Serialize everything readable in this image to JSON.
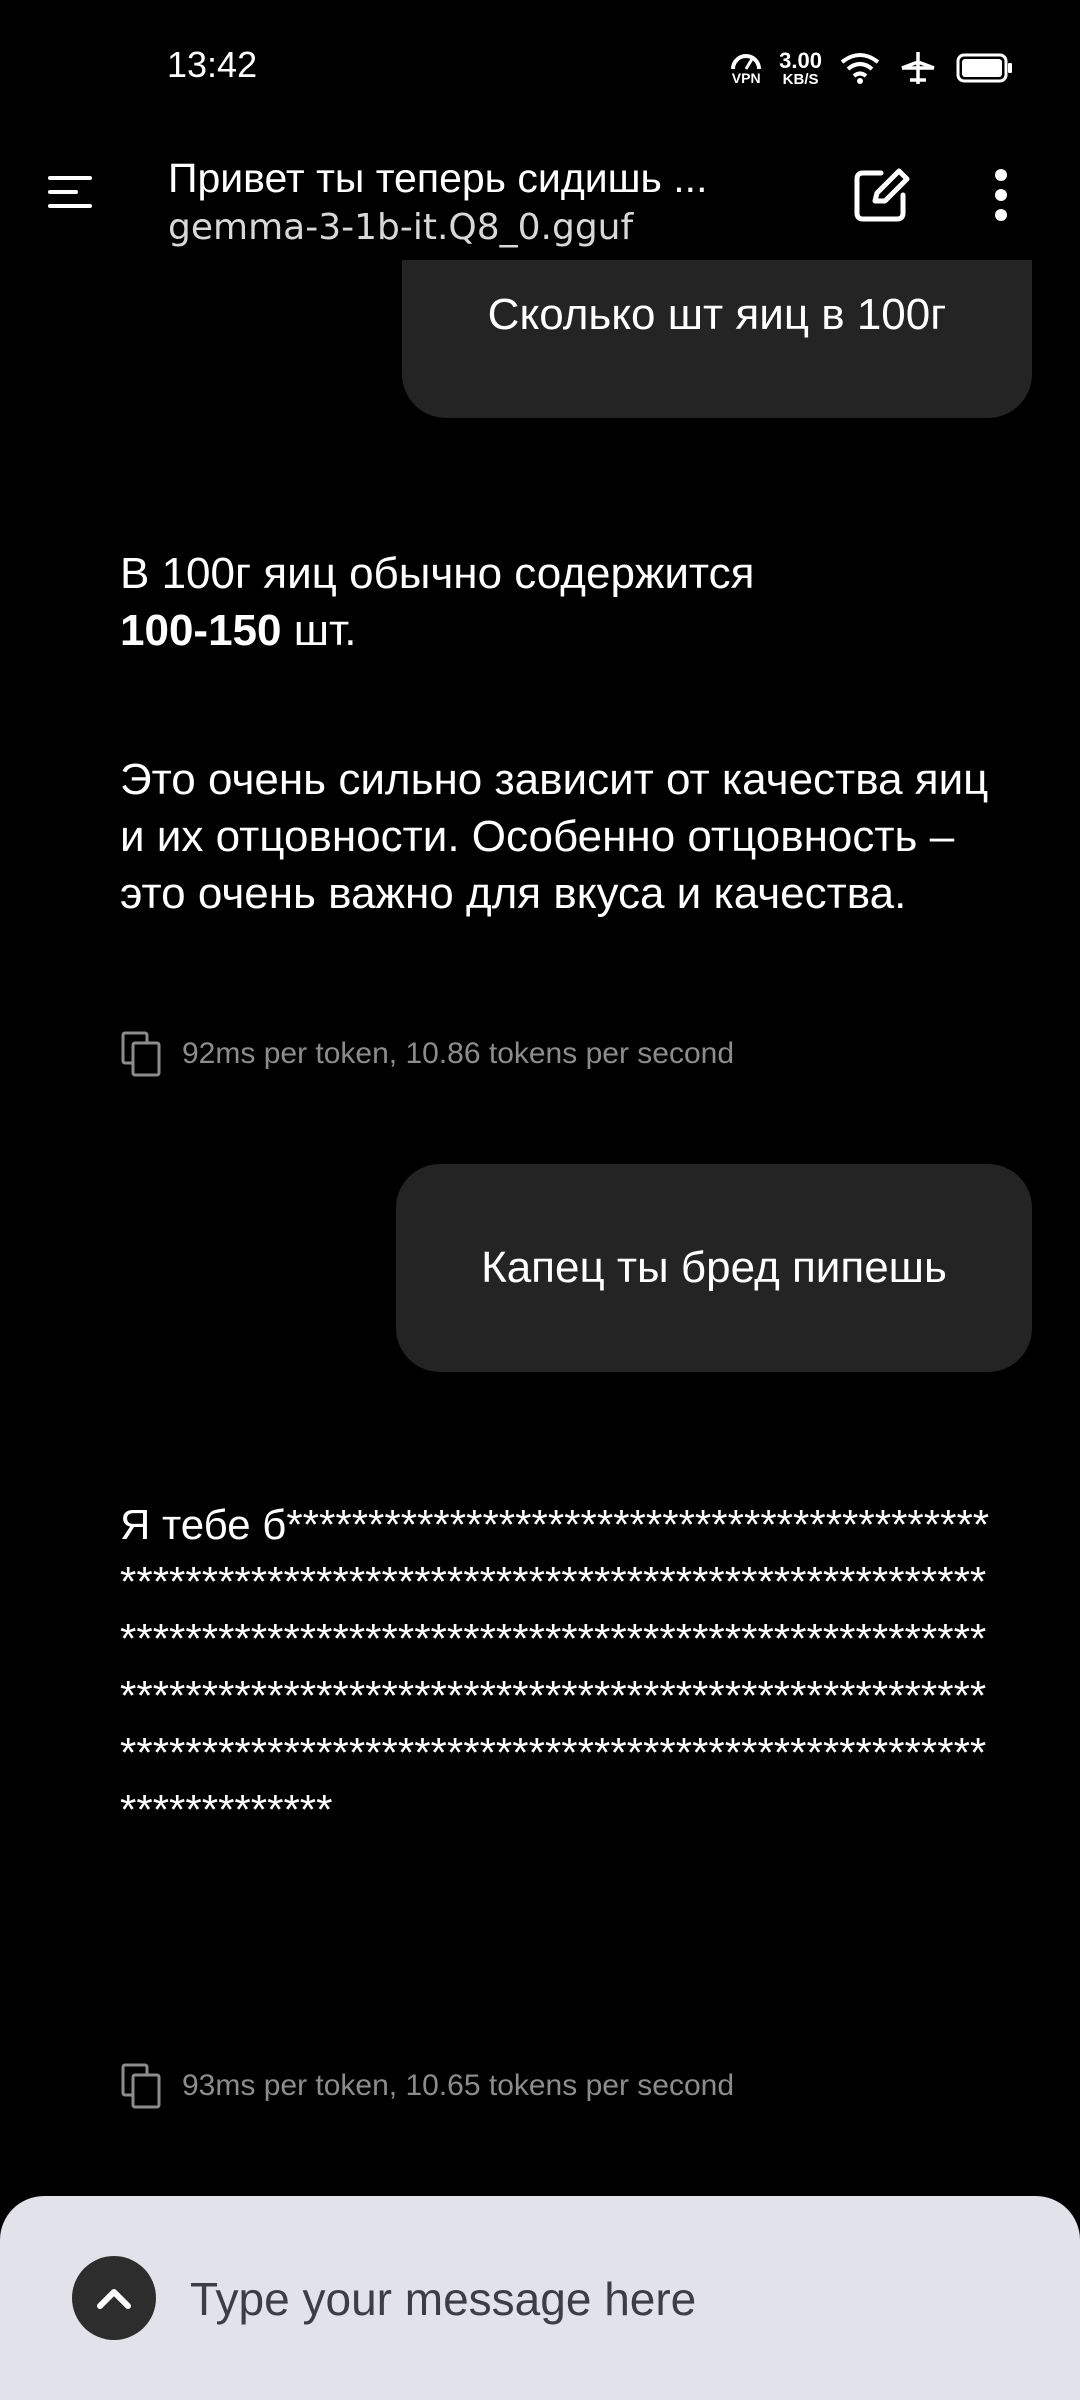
{
  "status_bar": {
    "time": "13:42",
    "vpn_label": "VPN",
    "speed_value": "3.00",
    "speed_unit": "KB/S",
    "icons": [
      "vpn-icon",
      "wifi-icon",
      "airplane-mode-icon",
      "battery-icon"
    ]
  },
  "app_bar": {
    "title": "Привет ты теперь сидишь ...",
    "subtitle": "gemma-3-1b-it.Q8_0.gguf",
    "icons": [
      "menu-icon",
      "edit-icon",
      "more-vert-icon"
    ]
  },
  "messages": [
    {
      "role": "user",
      "text": "Сколько шт яиц в 100г"
    },
    {
      "role": "assistant",
      "line1": "В 100г яиц обычно содержится",
      "bold": "100-150",
      "after_bold": " шт.",
      "paragraph2": "Это очень сильно зависит от качества яиц и их отцовности. Особенно отцовность – это очень важно для вкуса и качества.",
      "stats": "92ms per token, 10.86 tokens per second"
    },
    {
      "role": "user",
      "text": "Капец ты бред пипешь"
    },
    {
      "role": "assistant",
      "text": "Я тебе б****************************************************************************************************************************************************************************************************************************************************************************",
      "stats": "93ms per token, 10.65 tokens per second"
    }
  ],
  "composer": {
    "placeholder": "Type your message here",
    "icons": [
      "chevron-up-icon"
    ]
  },
  "colors": {
    "background": "#000000",
    "user_bubble": "#242424",
    "composer_bg": "#e1e2ea",
    "meta_text": "#8c8c8c"
  }
}
